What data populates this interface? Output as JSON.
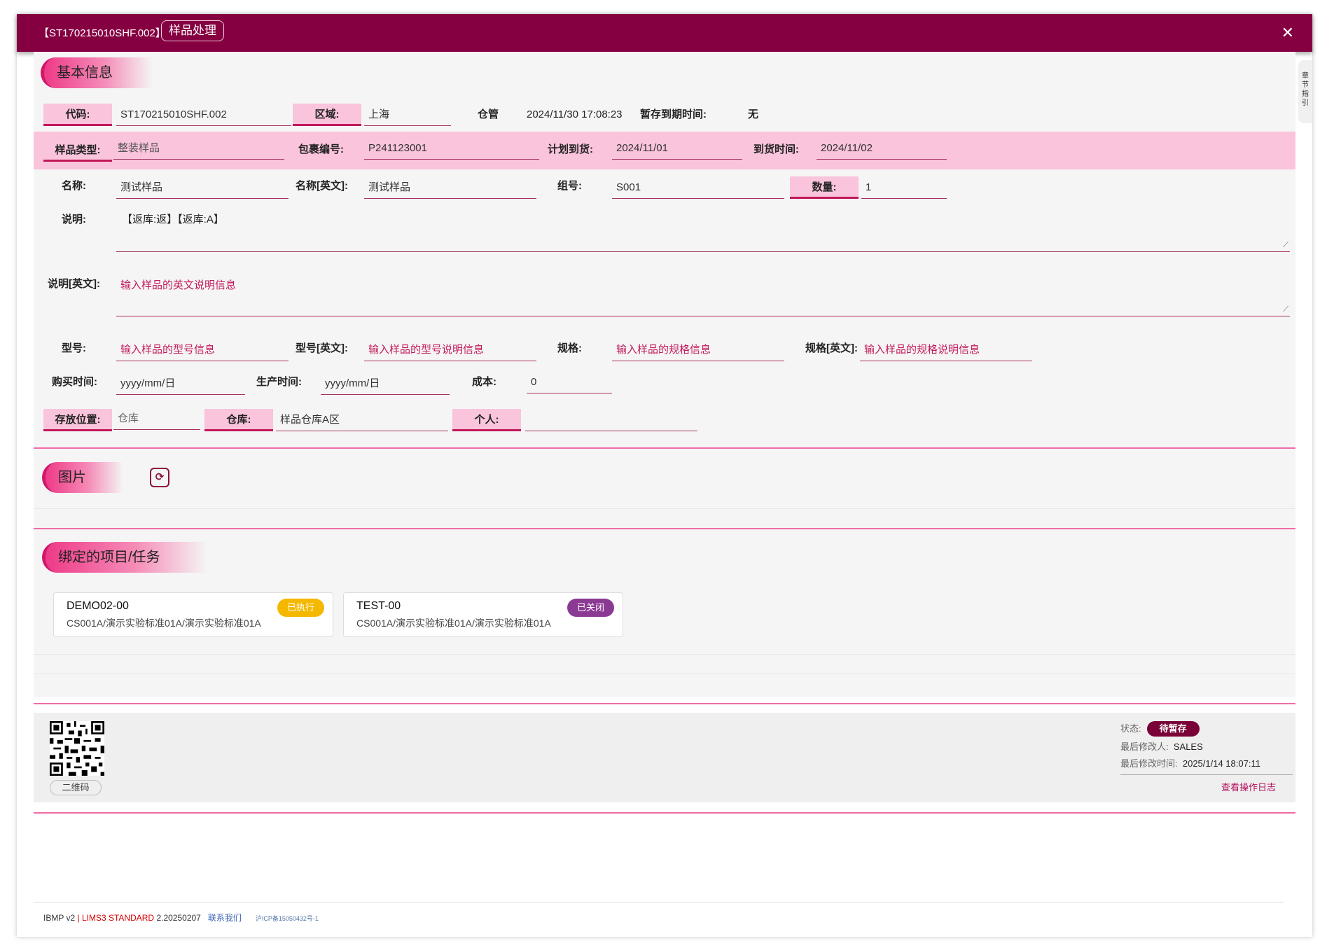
{
  "window": {
    "code": "【ST170215010SHF.002】",
    "badge": "样品处理",
    "side_tab": "章节指引"
  },
  "basic": {
    "title": "基本信息",
    "code_label": "代码:",
    "code_value": "ST170215010SHF.002",
    "region_label": "区域:",
    "region_value": "上海",
    "warehouse_mgr_label": "仓管",
    "datetime": "2024/11/30 17:08:23",
    "temp_expire_label": "暂存到期时间:",
    "temp_expire_value": "无",
    "sample_type_label": "样品类型:",
    "sample_type_value": "整装样品",
    "package_no_label": "包裹编号:",
    "package_no_value": "P241123001",
    "planned_arrival_label": "计划到货:",
    "planned_arrival_value": "2024/11/01",
    "arrival_time_label": "到货时间:",
    "arrival_time_value": "2024/11/02",
    "name_label": "名称:",
    "name_value": "测试样品",
    "name_en_label": "名称[英文]:",
    "name_en_value": "测试样品",
    "group_label": "组号:",
    "group_value": "S001",
    "qty_label": "数量:",
    "qty_value": "1",
    "desc_label": "说明:",
    "desc_value": "【返库:返】【返库:A】",
    "desc_en_label": "说明[英文]:",
    "desc_en_placeholder": "输入样品的英文说明信息",
    "model_label": "型号:",
    "model_placeholder": "输入样品的型号信息",
    "model_en_label": "型号[英文]:",
    "model_en_placeholder": "输入样品的型号说明信息",
    "spec_label": "规格:",
    "spec_placeholder": "输入样品的规格信息",
    "spec_en_label": "规格[英文]:",
    "spec_en_placeholder": "输入样品的规格说明信息",
    "purchase_label": "购买时间:",
    "purchase_value": "yyyy/mm/日",
    "production_label": "生产时间:",
    "production_value": "yyyy/mm/日",
    "cost_label": "成本:",
    "cost_value": "0",
    "storage_label": "存放位置:",
    "storage_value": "仓库",
    "warehouse_label": "仓库:",
    "warehouse_value": "样品仓库A区",
    "personal_label": "个人:",
    "personal_value": ""
  },
  "images": {
    "title": "图片",
    "refresh_icon": "⟳"
  },
  "bound": {
    "title": "绑定的项目/任务",
    "cards": [
      {
        "name": "DEMO02-00",
        "desc": "CS001A/演示实验标准01A/演示实验标准01A",
        "status": "已执行",
        "color": "#f5b800"
      },
      {
        "name": "TEST-00",
        "desc": "CS001A/演示实验标准01A/演示实验标准01A",
        "status": "已关闭",
        "color": "#8a3a93"
      }
    ]
  },
  "footer": {
    "qr_label": "二维码",
    "status_label": "状态:",
    "status_value": "待暂存",
    "modifier_label": "最后修改人:",
    "modifier_value": "SALES",
    "modified_label": "最后修改时间:",
    "modified_value": "2025/1/14 18:07:11",
    "log_link": "查看操作日志"
  },
  "bottom": {
    "app": "IBMP  v2",
    "sep": "|",
    "product": "LIMS3 STANDARD",
    "version": "2.20250207",
    "contact": "联系我们",
    "icp": "沪ICP备15050432号-1"
  },
  "colors": {
    "titlebar": "#850041",
    "accent": "#c2185b",
    "band": "#f9c4dc"
  }
}
